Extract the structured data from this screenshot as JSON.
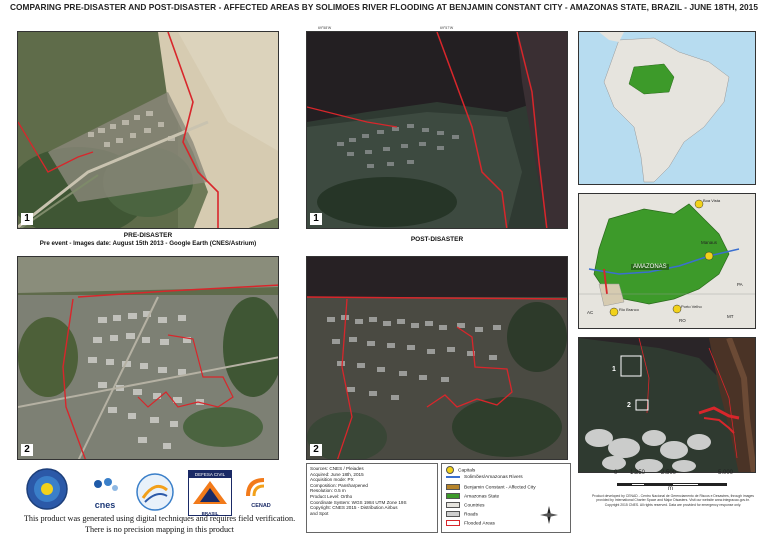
{
  "title": "COMPARING PRE-DISASTER AND POST-DISASTER -  AFFECTED AREAS BY SOLIMOES RIVER FLOODING AT BENJAMIN CONSTANT CITY - AMAZONAS STATE, BRAZIL - JUNE 18TH, 2015",
  "panels": {
    "pre_caption_title": "PRE-DISASTER",
    "pre_caption_sub": "Pre event - Images date: August 15th 2013 - Google Earth (CNES/Astrium)",
    "post_caption_title": "POST-DISASTER",
    "badge_1": "1",
    "badge_2": "2"
  },
  "inset_labels": {
    "state": "AMAZONAS",
    "manaus": "Manaus",
    "pa": "PA",
    "mt": "MT",
    "ro": "RO",
    "ac": "AC",
    "rio_branco": "Rio Branco",
    "porto_velho": "Porto Velho",
    "boa_vista": "Boa Vista",
    "overview_1": "1",
    "overview_2": "2"
  },
  "metadata": {
    "lines": [
      "Sources: CNES / Pleiades",
      "Acquired: June 18th, 2015",
      "Acquisition mode: PX",
      "Composition: Pansharpened",
      "Resolution: 0.5 m",
      "Product Level: Ortho",
      "Coordinate System: WGS 1984 UTM Zone 19S",
      "Copyright: CNES 2015 - Distribution Airbus",
      "and Spot"
    ]
  },
  "legend": {
    "items": [
      {
        "label": "Capitals",
        "kind": "capital"
      },
      {
        "label": "Solimões/Amazonas Rivers",
        "kind": "river"
      },
      {
        "label": "Benjamin Constant - Affected City",
        "kind": "city"
      },
      {
        "label": "Amazonas State",
        "kind": "state"
      },
      {
        "label": "Countries",
        "kind": "countries"
      },
      {
        "label": "Roads",
        "kind": "roads"
      },
      {
        "label": "Flooded Areas",
        "kind": "flooded"
      }
    ]
  },
  "scalebar": {
    "ticks": [
      "0",
      "1.250",
      "2.500",
      "5.000"
    ],
    "unit": "m"
  },
  "credits": "Product developed by CENAD - Centro Nacional de Gerenciamento de Riscos e Desastres, through images provided by International Charter Space and Major Disasters. Visit our website www.integracao.gov.br. Copyright 2015 CNES. All rights reserved. Data are provided for emergency response only.",
  "footer": {
    "line1": "This product was generated using digital techniques and requires field verification.",
    "line2": "There is no precision mapping in this product"
  },
  "logos": {
    "cnes": "cnes",
    "defesa_top": "DEFESA CIVIL",
    "defesa_bottom": "BRASIL",
    "cenad": "CENAD"
  },
  "colors": {
    "flood_outline": "#d8262b",
    "state_green": "#3d9a2a",
    "river_blue": "#3a6fd0",
    "capital_yellow": "#f2d21a",
    "ocean_blue": "#b7dcf0",
    "land_grey": "#e6e4de"
  }
}
